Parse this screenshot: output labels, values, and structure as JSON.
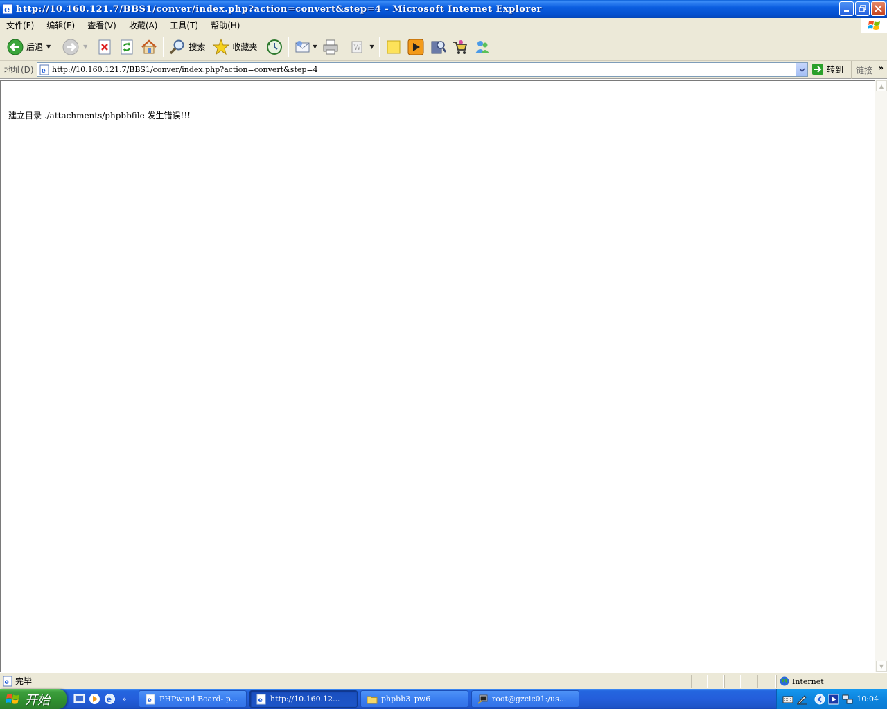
{
  "window": {
    "title": "http://10.160.121.7/BBS1/conver/index.php?action=convert&step=4 - Microsoft Internet Explorer"
  },
  "menu": {
    "items": [
      "文件(F)",
      "编辑(E)",
      "查看(V)",
      "收藏(A)",
      "工具(T)",
      "帮助(H)"
    ]
  },
  "toolbar": {
    "back_label": "后退",
    "search_label": "搜索",
    "favorites_label": "收藏夹"
  },
  "address": {
    "label": "地址(D)",
    "url": "http://10.160.121.7/BBS1/conver/index.php?action=convert&step=4",
    "go_label": "转到",
    "links_label": "链接"
  },
  "content": {
    "message": "建立目录 ./attachments/phpbbfile 发生错误!!!"
  },
  "status": {
    "text": "完毕",
    "zone": "Internet"
  },
  "taskbar": {
    "start_label": "开始",
    "tasks": [
      {
        "label": "PHPwind Board- p...",
        "icon": "ie-page-icon"
      },
      {
        "label": "http://10.160.12...",
        "icon": "ie-page-icon"
      },
      {
        "label": "phpbb3_pw6",
        "icon": "folder-icon"
      },
      {
        "label": "root@gzcic01:/us...",
        "icon": "terminal-icon"
      }
    ],
    "clock": "10:04"
  }
}
